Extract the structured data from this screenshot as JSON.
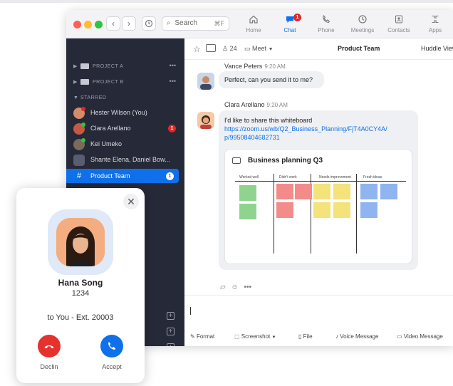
{
  "search": {
    "placeholder": "Search",
    "shortcut": "⌘F"
  },
  "nav": [
    {
      "label": "Home",
      "icon": "home-icon"
    },
    {
      "label": "Chat",
      "icon": "chat-icon",
      "badge": "1"
    },
    {
      "label": "Phone",
      "icon": "phone-icon"
    },
    {
      "label": "Meetings",
      "icon": "clock-icon"
    },
    {
      "label": "Contacts",
      "icon": "contacts-icon"
    },
    {
      "label": "Apps",
      "icon": "apps-icon"
    }
  ],
  "sidebar": {
    "folders": [
      {
        "label": "PROJECT A",
        "more": "•••"
      },
      {
        "label": "PROJECT B",
        "more": "•••"
      }
    ],
    "starred_label": "STARRED",
    "items": [
      {
        "label": "Hester Wilson (You)",
        "avatar_color": "#d48b6a"
      },
      {
        "label": "Clara Arellano",
        "badge": "1",
        "avatar_color": "#c45a43"
      },
      {
        "label": "Kei Umeko",
        "avatar_color": "#7b6a5c"
      },
      {
        "label": "Shante Elena, Daniel Bow...",
        "avatar_color": "#5a5d70"
      },
      {
        "label": "Product Team",
        "badge": "1",
        "active": true
      }
    ]
  },
  "channel": {
    "title": "Product Team",
    "members": "24",
    "meet_label": "Meet",
    "huddle_label": "Huddle View"
  },
  "messages": [
    {
      "author": "Vance Peters",
      "time": "9:20 AM",
      "text": "Perfect, can you send it to me?"
    },
    {
      "author": "Clara Arellano",
      "time": "9:20 AM",
      "text": "I'd like to share this whiteboard",
      "link": "https://zoom.us/wb/Q2_Business_Planning/FjT4l0CY4A/p/99508404682731",
      "link_line1": "https://zoom.us/wb/Q2_Business_Planning/FjT4A0CY4A/",
      "link_line2": "p/99508404682731",
      "card_title": "Business planning Q3",
      "columns": [
        "Worked well",
        "Didn't work",
        "Needs improvement",
        "Fresh ideas"
      ]
    }
  ],
  "composer": {
    "tools": [
      {
        "label": "Format",
        "icon": "format-icon"
      },
      {
        "label": "Screenshot",
        "icon": "screenshot-icon"
      },
      {
        "label": "File",
        "icon": "file-icon"
      },
      {
        "label": "Voice Message",
        "icon": "microphone-icon"
      },
      {
        "label": "Video Message",
        "icon": "video-icon"
      }
    ]
  },
  "call": {
    "name": "Hana Song",
    "ext": "1234",
    "to": "to You - Ext. 20003",
    "decline_label": "Declin",
    "accept_label": "Accept",
    "colors": {
      "decline": "#e5322d",
      "accept": "#0e71eb"
    }
  },
  "colors": {
    "accent": "#0e71eb",
    "sidebar": "#262938"
  }
}
